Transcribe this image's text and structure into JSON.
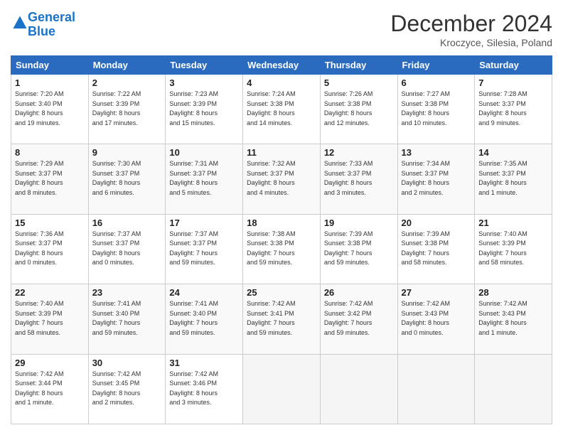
{
  "header": {
    "logo_line1": "General",
    "logo_line2": "Blue",
    "month": "December 2024",
    "location": "Kroczyce, Silesia, Poland"
  },
  "weekdays": [
    "Sunday",
    "Monday",
    "Tuesday",
    "Wednesday",
    "Thursday",
    "Friday",
    "Saturday"
  ],
  "weeks": [
    [
      {
        "day": "1",
        "info": "Sunrise: 7:20 AM\nSunset: 3:40 PM\nDaylight: 8 hours\nand 19 minutes."
      },
      {
        "day": "2",
        "info": "Sunrise: 7:22 AM\nSunset: 3:39 PM\nDaylight: 8 hours\nand 17 minutes."
      },
      {
        "day": "3",
        "info": "Sunrise: 7:23 AM\nSunset: 3:39 PM\nDaylight: 8 hours\nand 15 minutes."
      },
      {
        "day": "4",
        "info": "Sunrise: 7:24 AM\nSunset: 3:38 PM\nDaylight: 8 hours\nand 14 minutes."
      },
      {
        "day": "5",
        "info": "Sunrise: 7:26 AM\nSunset: 3:38 PM\nDaylight: 8 hours\nand 12 minutes."
      },
      {
        "day": "6",
        "info": "Sunrise: 7:27 AM\nSunset: 3:38 PM\nDaylight: 8 hours\nand 10 minutes."
      },
      {
        "day": "7",
        "info": "Sunrise: 7:28 AM\nSunset: 3:37 PM\nDaylight: 8 hours\nand 9 minutes."
      }
    ],
    [
      {
        "day": "8",
        "info": "Sunrise: 7:29 AM\nSunset: 3:37 PM\nDaylight: 8 hours\nand 8 minutes."
      },
      {
        "day": "9",
        "info": "Sunrise: 7:30 AM\nSunset: 3:37 PM\nDaylight: 8 hours\nand 6 minutes."
      },
      {
        "day": "10",
        "info": "Sunrise: 7:31 AM\nSunset: 3:37 PM\nDaylight: 8 hours\nand 5 minutes."
      },
      {
        "day": "11",
        "info": "Sunrise: 7:32 AM\nSunset: 3:37 PM\nDaylight: 8 hours\nand 4 minutes."
      },
      {
        "day": "12",
        "info": "Sunrise: 7:33 AM\nSunset: 3:37 PM\nDaylight: 8 hours\nand 3 minutes."
      },
      {
        "day": "13",
        "info": "Sunrise: 7:34 AM\nSunset: 3:37 PM\nDaylight: 8 hours\nand 2 minutes."
      },
      {
        "day": "14",
        "info": "Sunrise: 7:35 AM\nSunset: 3:37 PM\nDaylight: 8 hours\nand 1 minute."
      }
    ],
    [
      {
        "day": "15",
        "info": "Sunrise: 7:36 AM\nSunset: 3:37 PM\nDaylight: 8 hours\nand 0 minutes."
      },
      {
        "day": "16",
        "info": "Sunrise: 7:37 AM\nSunset: 3:37 PM\nDaylight: 8 hours\nand 0 minutes."
      },
      {
        "day": "17",
        "info": "Sunrise: 7:37 AM\nSunset: 3:37 PM\nDaylight: 7 hours\nand 59 minutes."
      },
      {
        "day": "18",
        "info": "Sunrise: 7:38 AM\nSunset: 3:38 PM\nDaylight: 7 hours\nand 59 minutes."
      },
      {
        "day": "19",
        "info": "Sunrise: 7:39 AM\nSunset: 3:38 PM\nDaylight: 7 hours\nand 59 minutes."
      },
      {
        "day": "20",
        "info": "Sunrise: 7:39 AM\nSunset: 3:38 PM\nDaylight: 7 hours\nand 58 minutes."
      },
      {
        "day": "21",
        "info": "Sunrise: 7:40 AM\nSunset: 3:39 PM\nDaylight: 7 hours\nand 58 minutes."
      }
    ],
    [
      {
        "day": "22",
        "info": "Sunrise: 7:40 AM\nSunset: 3:39 PM\nDaylight: 7 hours\nand 58 minutes."
      },
      {
        "day": "23",
        "info": "Sunrise: 7:41 AM\nSunset: 3:40 PM\nDaylight: 7 hours\nand 59 minutes."
      },
      {
        "day": "24",
        "info": "Sunrise: 7:41 AM\nSunset: 3:40 PM\nDaylight: 7 hours\nand 59 minutes."
      },
      {
        "day": "25",
        "info": "Sunrise: 7:42 AM\nSunset: 3:41 PM\nDaylight: 7 hours\nand 59 minutes."
      },
      {
        "day": "26",
        "info": "Sunrise: 7:42 AM\nSunset: 3:42 PM\nDaylight: 7 hours\nand 59 minutes."
      },
      {
        "day": "27",
        "info": "Sunrise: 7:42 AM\nSunset: 3:43 PM\nDaylight: 8 hours\nand 0 minutes."
      },
      {
        "day": "28",
        "info": "Sunrise: 7:42 AM\nSunset: 3:43 PM\nDaylight: 8 hours\nand 1 minute."
      }
    ],
    [
      {
        "day": "29",
        "info": "Sunrise: 7:42 AM\nSunset: 3:44 PM\nDaylight: 8 hours\nand 1 minute."
      },
      {
        "day": "30",
        "info": "Sunrise: 7:42 AM\nSunset: 3:45 PM\nDaylight: 8 hours\nand 2 minutes."
      },
      {
        "day": "31",
        "info": "Sunrise: 7:42 AM\nSunset: 3:46 PM\nDaylight: 8 hours\nand 3 minutes."
      },
      null,
      null,
      null,
      null
    ]
  ]
}
